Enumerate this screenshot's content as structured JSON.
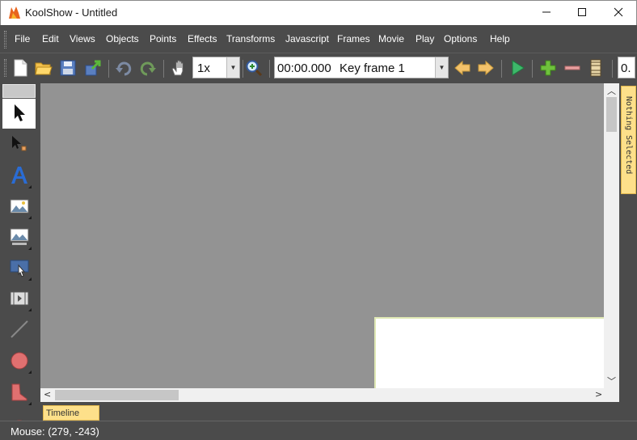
{
  "window": {
    "title": "KoolShow - Untitled",
    "logo_icon": "koolshow-logo-icon",
    "controls": [
      "minimize-icon",
      "maximize-icon",
      "close-icon"
    ]
  },
  "menu": {
    "items": [
      "File",
      "Edit",
      "Views",
      "Objects",
      "Points",
      "Effects",
      "Transforms",
      "Javascript",
      "Frames",
      "Movie",
      "Play",
      "Options",
      "Help"
    ]
  },
  "toolbar": {
    "icons": [
      "new-document-icon",
      "open-folder-icon",
      "save-icon",
      "export-icon",
      "undo-icon",
      "redo-icon",
      "hand-pan-icon",
      "zoom-in-icon",
      "previous-frame-icon",
      "next-frame-icon",
      "play-icon",
      "add-frame-icon",
      "remove-frame-icon",
      "film-strip-icon"
    ],
    "zoom_value": "1x",
    "frame_time": "00:00.000",
    "frame_name": "Key frame 1",
    "truncated_value": "0."
  },
  "tools": {
    "items": [
      "select-arrow-icon",
      "point-select-icon",
      "text-tool-icon",
      "image-tool-icon",
      "slideshow-tool-icon",
      "button-tool-icon",
      "movie-tool-icon",
      "line-tool-icon",
      "circle-tool-icon",
      "polygon-tool-icon"
    ],
    "active": "select-arrow-icon"
  },
  "side_panel": {
    "label": "Nothing Selected"
  },
  "timeline": {
    "label": "Timeline"
  },
  "status": {
    "mouse": "Mouse: (279, -243)"
  },
  "colors": {
    "chrome": "#4b4b4b",
    "canvas": "#939393",
    "stage": "#ffffff",
    "tab_yellow": "#fde08a"
  }
}
